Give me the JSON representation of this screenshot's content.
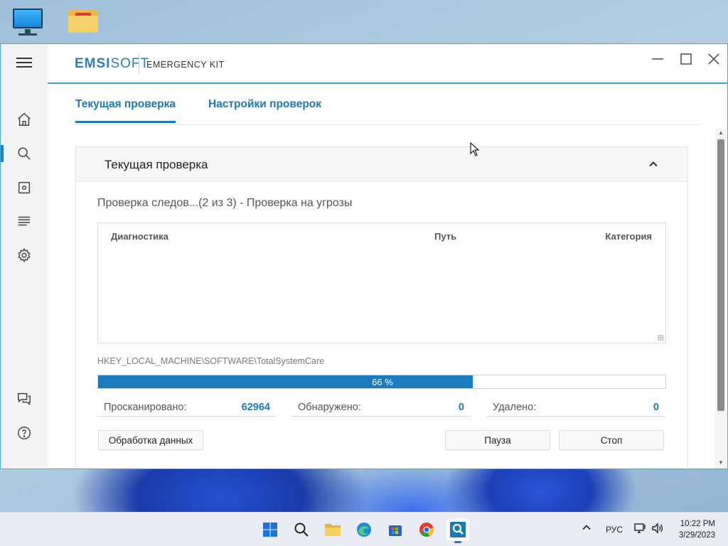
{
  "window": {
    "brand_emsi": "EMSI",
    "brand_soft": "SOFT",
    "product": "EMERGENCY KIT"
  },
  "tabs": [
    {
      "label": "Текущая проверка",
      "active": true
    },
    {
      "label": "Настройки проверок",
      "active": false
    }
  ],
  "panel": {
    "title": "Текущая проверка",
    "status": "Проверка следов...(2 из 3) - Проверка на угрозы",
    "columns": [
      "Диагностика",
      "Путь",
      "Категория"
    ],
    "current_path": "HKEY_LOCAL_MACHINE\\SOFTWARE\\TotalSystemCare",
    "progress_percent": 66,
    "progress_label": "66 %",
    "stats": [
      {
        "label": "Просканировано:",
        "value": "62964"
      },
      {
        "label": "Обнаружено:",
        "value": "0"
      },
      {
        "label": "Удалено:",
        "value": "0"
      }
    ],
    "buttons": {
      "data_processing": "Обработка данных",
      "pause": "Пауза",
      "stop": "Стоп"
    }
  },
  "sidebar_icons": [
    "home-icon",
    "search-icon",
    "quarantine-icon",
    "logs-icon",
    "settings-icon",
    "chat-icon",
    "help-icon"
  ],
  "taskbar": {
    "language": "РУС",
    "time": "10:22 PM",
    "date": "3/29/2023"
  },
  "colors": {
    "accent": "#1b7ab3",
    "progress": "#1a7bbf"
  }
}
